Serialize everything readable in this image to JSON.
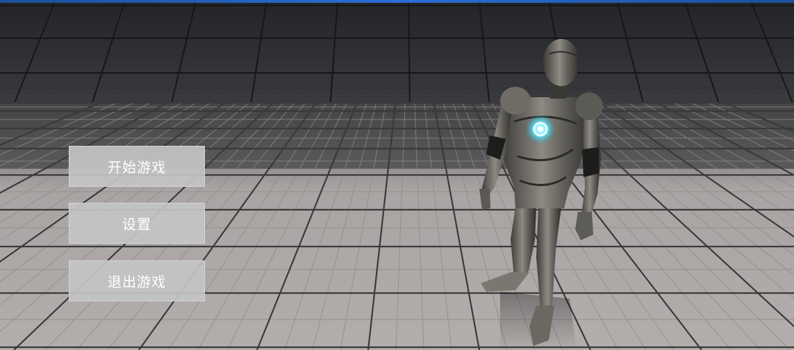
{
  "menu": {
    "start_label": "开始游戏",
    "settings_label": "设置",
    "quit_label": "退出游戏"
  },
  "colors": {
    "accent_bar": "#2a6fd6",
    "button_bg": "#c4c4c4",
    "button_text": "#ffffff",
    "chest_glow": "#6ff0ff"
  }
}
